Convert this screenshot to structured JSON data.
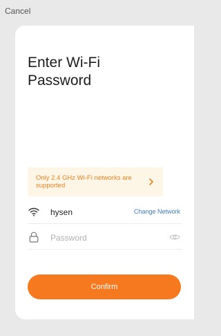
{
  "header": {
    "cancel_label": "Cancel"
  },
  "card": {
    "title_line1": "Enter Wi-Fi",
    "title_line2": "Password",
    "notice": {
      "text": "Only 2.4 GHz Wi-Fi networks are supported",
      "icon": "chevron-right-icon"
    },
    "wifi": {
      "icon": "wifi-icon",
      "network_name": "hysen",
      "change_label": "Change Network"
    },
    "password": {
      "icon": "lock-icon",
      "placeholder": "Password",
      "value": "",
      "toggle_icon": "eye-icon"
    },
    "confirm_label": "Confirm"
  },
  "colors": {
    "accent": "#f7791f",
    "notice_bg": "#fdf5e6",
    "notice_text": "#e8821e",
    "link": "#3a7bc8",
    "page_bg": "#e9e9e9"
  }
}
